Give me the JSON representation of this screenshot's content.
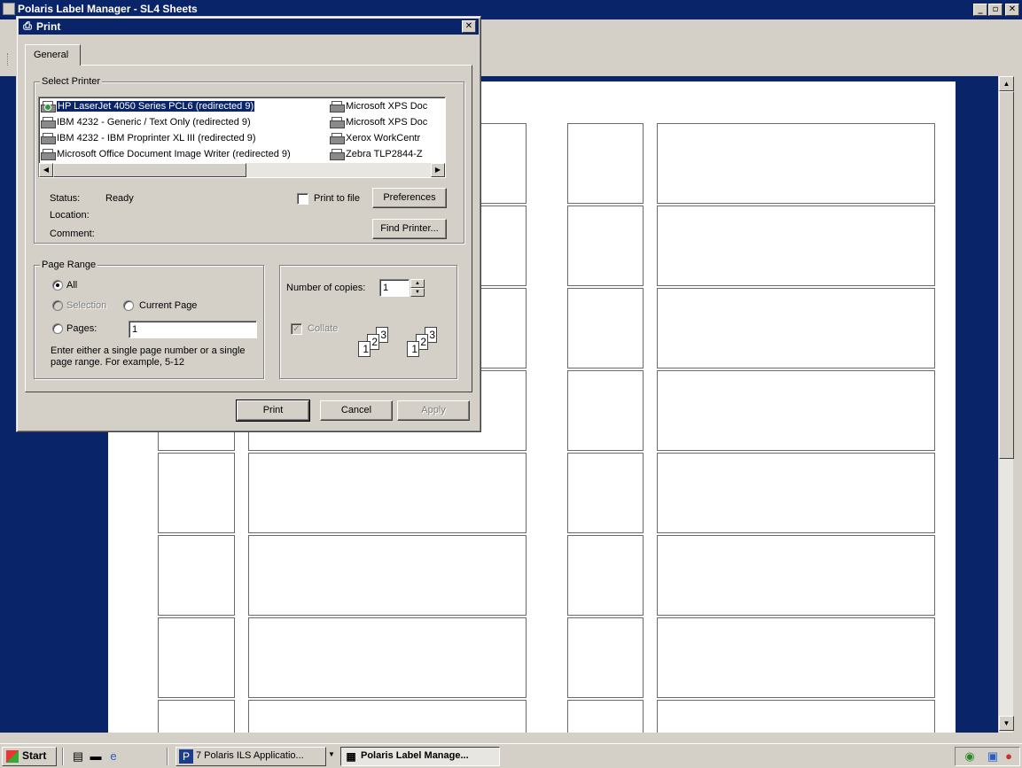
{
  "app": {
    "title": "Polaris Label Manager - SL4 Sheets",
    "min_glyph": "_",
    "max_glyph": "▫",
    "close_glyph": "✕"
  },
  "dialog": {
    "title": "Print",
    "close_glyph": "✕",
    "tab_general": "General",
    "select_printer": {
      "label": "Select Printer",
      "printers": [
        "HP LaserJet 4050 Series PCL6 (redirected 9)",
        "IBM 4232 - Generic / Text Only (redirected 9)",
        "IBM 4232 - IBM Proprinter XL III (redirected 9)",
        "Microsoft Office Document Image Writer (redirected 9)",
        "Microsoft XPS Doc",
        "Microsoft XPS Doc",
        "Xerox WorkCentr",
        "Zebra  TLP2844-Z"
      ],
      "selected_index": 0,
      "scroll_left_glyph": "◀",
      "scroll_right_glyph": "▶"
    },
    "status_label": "Status:",
    "status_value": "Ready",
    "location_label": "Location:",
    "comment_label": "Comment:",
    "print_to_file": "Print to file",
    "preferences_button": "Preferences",
    "find_printer_button": "Find Printer...",
    "page_range": {
      "label": "Page Range",
      "all": "All",
      "selection": "Selection",
      "current_page": "Current Page",
      "pages": "Pages:",
      "pages_value": "1",
      "hint": "Enter either a single page number or a single page range.  For example, 5-12"
    },
    "copies": {
      "label": "Number of copies:",
      "value": "1",
      "collate": "Collate",
      "collate_checked_glyph": "✓",
      "spin_up_glyph": "▲",
      "spin_down_glyph": "▼"
    },
    "buttons": {
      "print": "Print",
      "cancel": "Cancel",
      "apply": "Apply"
    }
  },
  "scrollbar": {
    "up_glyph": "▲",
    "down_glyph": "▼"
  },
  "taskbar": {
    "start": "Start",
    "tasks": [
      "7 Polaris ILS Applicatio...",
      "Polaris Label Manage..."
    ],
    "active_index": 1,
    "dropdown_glyph": "▼"
  }
}
